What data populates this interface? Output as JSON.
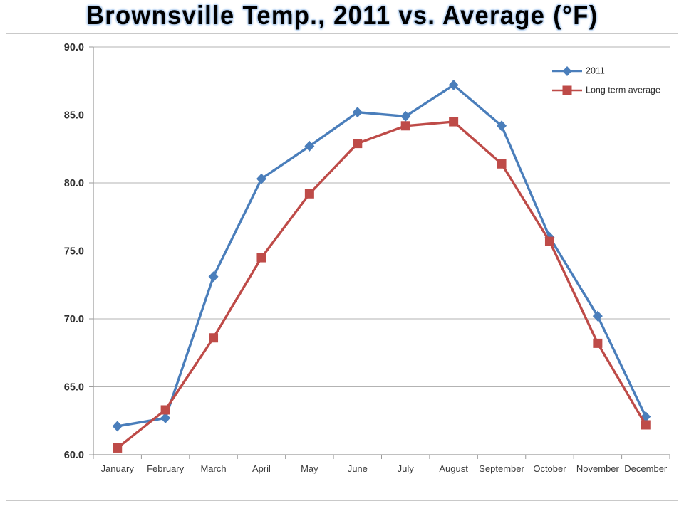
{
  "title": "Brownsville Temp., 2011 vs. Average (°F)",
  "legend": {
    "position": "top-right",
    "entries": [
      {
        "label": "2011",
        "color": "#4a7ebb",
        "marker": "diamond"
      },
      {
        "label": "Long term average",
        "color": "#be4b48",
        "marker": "square"
      }
    ]
  },
  "colors": {
    "series_2011": "#4a7ebb",
    "series_average": "#be4b48",
    "gridline": "#b3b3b3",
    "axis": "#9a9a9a",
    "title_text": "#000000",
    "title_glow": "#b9d2ef",
    "plot_background": "#ffffff",
    "plot_border": "#c9c9c9"
  },
  "axes": {
    "y": {
      "min": 60.0,
      "max": 90.0,
      "step": 5.0,
      "ticks": [
        "60.0",
        "65.0",
        "70.0",
        "75.0",
        "80.0",
        "85.0",
        "90.0"
      ],
      "label": ""
    },
    "x": {
      "label": "",
      "ticks": [
        "January",
        "February",
        "March",
        "April",
        "May",
        "June",
        "July",
        "August",
        "September",
        "October",
        "November",
        "December"
      ]
    },
    "gridlines": "horizontal"
  },
  "chart_data": {
    "type": "line",
    "title": "Brownsville Temp., 2011 vs. Average (°F)",
    "xlabel": "",
    "ylabel": "",
    "ylim": [
      60.0,
      90.0
    ],
    "ytick_step": 5.0,
    "grid": true,
    "legend_position": "top-right",
    "categories": [
      "January",
      "February",
      "March",
      "April",
      "May",
      "June",
      "July",
      "August",
      "September",
      "October",
      "November",
      "December"
    ],
    "series": [
      {
        "name": "2011",
        "color": "#4a7ebb",
        "marker": "diamond",
        "values": [
          62.1,
          62.7,
          73.1,
          80.3,
          82.7,
          85.2,
          84.9,
          87.2,
          84.2,
          76.0,
          70.2,
          62.8
        ]
      },
      {
        "name": "Long term average",
        "color": "#be4b48",
        "marker": "square",
        "values": [
          60.5,
          63.3,
          68.6,
          74.5,
          79.2,
          82.9,
          84.2,
          84.5,
          81.4,
          75.7,
          68.2,
          62.2
        ]
      }
    ]
  }
}
